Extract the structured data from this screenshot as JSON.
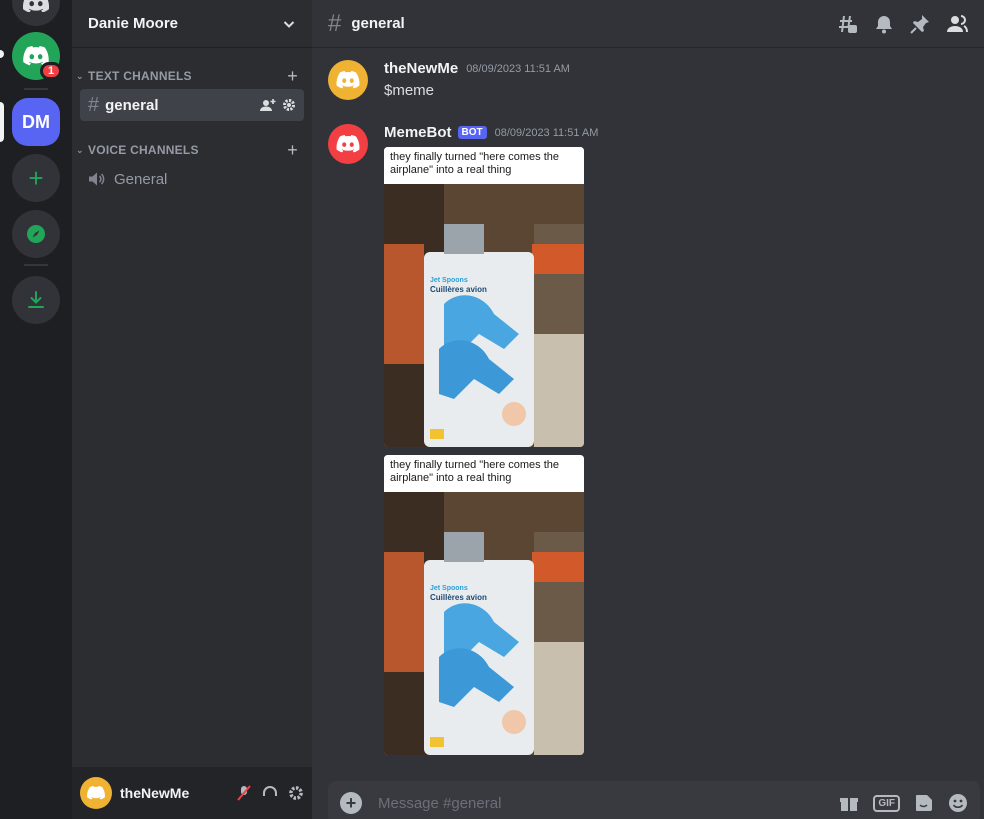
{
  "server_rail": {
    "dm_label": "DM",
    "notification_count": "1",
    "add_label": "+"
  },
  "sidebar": {
    "guild_name": "Danie Moore",
    "text_category": "TEXT CHANNELS",
    "voice_category": "VOICE CHANNELS",
    "text_channels": [
      {
        "name": "general"
      }
    ],
    "voice_channels": [
      {
        "name": "General"
      }
    ],
    "user": {
      "name": "theNewMe"
    }
  },
  "header": {
    "channel": "general"
  },
  "messages": [
    {
      "author": "theNewMe",
      "timestamp": "08/09/2023 11:51 AM",
      "content": "$meme",
      "avatar_color": "#f0b232"
    },
    {
      "author": "MemeBot",
      "badge": "BOT",
      "timestamp": "08/09/2023 11:51 AM",
      "avatar_color": "#f23f43",
      "images": [
        {
          "caption": "they finally turned \"here comes the airplane\" into a real thing",
          "product_title": "Jet Spoons",
          "product_subtitle": "Cuillères avion"
        },
        {
          "caption": "they finally turned \"here comes the airplane\" into a real thing",
          "product_title": "Jet Spoons",
          "product_subtitle": "Cuillères avion"
        }
      ]
    }
  ],
  "composer": {
    "placeholder": "Message #general"
  },
  "colors": {
    "accent": "#5865f2",
    "green": "#23a559",
    "red": "#f23f43",
    "orange": "#f0b232"
  }
}
